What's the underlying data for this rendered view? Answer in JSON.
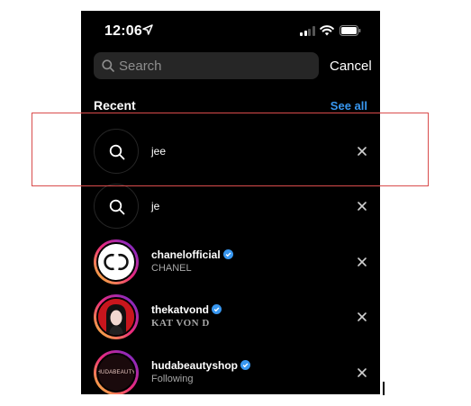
{
  "status_bar": {
    "time": "12:06"
  },
  "search": {
    "placeholder": "Search",
    "cancel_label": "Cancel"
  },
  "recent": {
    "title": "Recent",
    "see_all_label": "See all"
  },
  "items": [
    {
      "type": "query",
      "primary": "jee"
    },
    {
      "type": "query",
      "primary": "je"
    },
    {
      "type": "account",
      "primary": "chanelofficial",
      "secondary": "CHANEL",
      "verified": true,
      "avatar_icon": "chanel-logo-icon"
    },
    {
      "type": "account",
      "primary": "thekatvond",
      "secondary": "KAT VON D",
      "verified": true,
      "avatar_icon": "profile-photo"
    },
    {
      "type": "account",
      "primary": "hudabeautyshop",
      "secondary": "Following",
      "verified": true,
      "avatar_icon": "hudabeauty-logo-icon",
      "avatar_logo_text": "HUDABEAUTY"
    }
  ],
  "colors": {
    "accent": "#3897f0",
    "background": "#000000",
    "highlight_box": "#d94c4c"
  }
}
